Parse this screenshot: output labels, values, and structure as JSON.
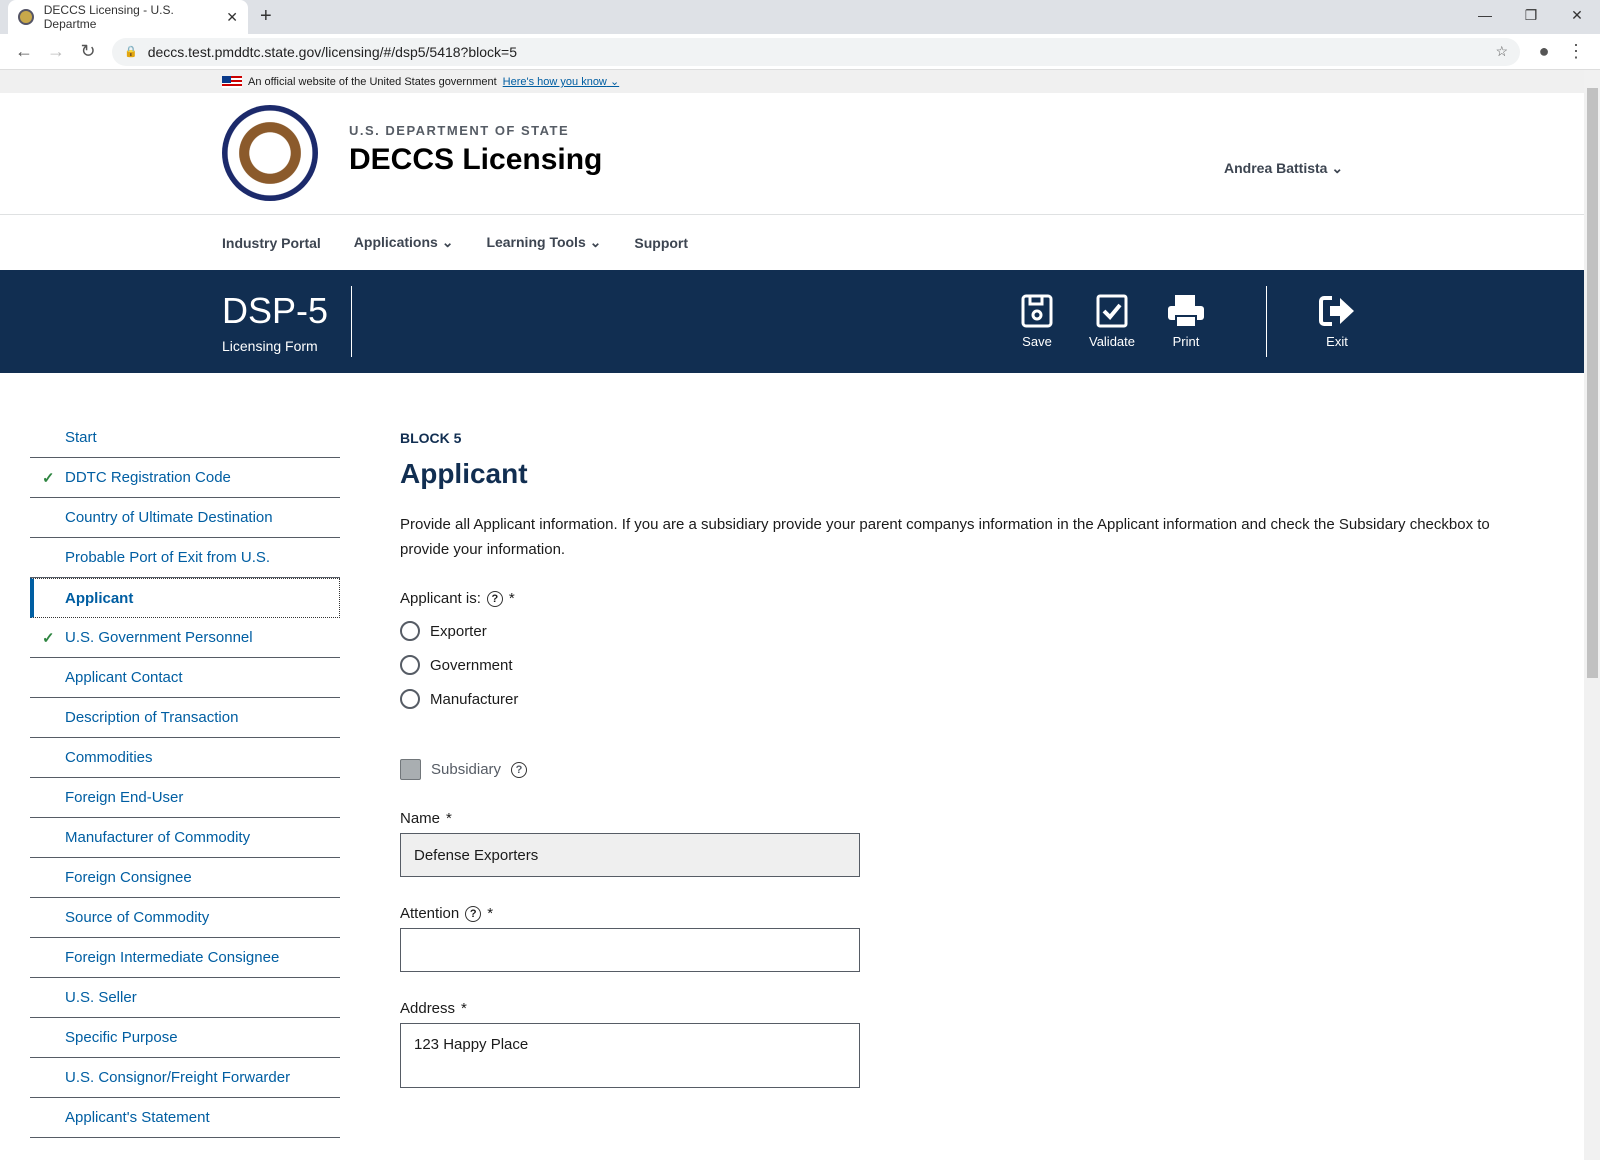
{
  "browser": {
    "tab_title": "DECCS Licensing - U.S. Departme",
    "url": "deccs.test.pmddtc.state.gov/licensing/#/dsp5/5418?block=5"
  },
  "gov_banner": {
    "text": "An official website of the United States government",
    "link": "Here's how you know"
  },
  "header": {
    "agency": "U.S. DEPARTMENT OF STATE",
    "title": "DECCS Licensing",
    "user": "Andrea Battista",
    "seal_text": "DEPARTMENT OF STATE UNITED STATES OF AMERICA"
  },
  "nav": [
    "Industry Portal",
    "Applications",
    "Learning Tools",
    "Support"
  ],
  "banner": {
    "form": "DSP-5",
    "subtitle": "Licensing Form",
    "save": "Save",
    "validate": "Validate",
    "print": "Print",
    "exit": "Exit",
    "bg_color": "#112e51"
  },
  "sidebar": [
    {
      "label": "Start",
      "done": false
    },
    {
      "label": "DDTC Registration Code",
      "done": true
    },
    {
      "label": "Country of Ultimate Destination",
      "done": false
    },
    {
      "label": "Probable Port of Exit from U.S.",
      "done": false
    },
    {
      "label": "Applicant",
      "done": false,
      "active": true
    },
    {
      "label": "U.S. Government Personnel",
      "done": true
    },
    {
      "label": "Applicant Contact",
      "done": false
    },
    {
      "label": "Description of Transaction",
      "done": false
    },
    {
      "label": "Commodities",
      "done": false
    },
    {
      "label": "Foreign End-User",
      "done": false
    },
    {
      "label": "Manufacturer of Commodity",
      "done": false
    },
    {
      "label": "Foreign Consignee",
      "done": false
    },
    {
      "label": "Source of Commodity",
      "done": false
    },
    {
      "label": "Foreign Intermediate Consignee",
      "done": false
    },
    {
      "label": "U.S. Seller",
      "done": false
    },
    {
      "label": "Specific Purpose",
      "done": false
    },
    {
      "label": "U.S. Consignor/Freight Forwarder",
      "done": false
    },
    {
      "label": "Applicant's Statement",
      "done": false
    }
  ],
  "main": {
    "block": "BLOCK 5",
    "title": "Applicant",
    "description": "Provide all Applicant information. If you are a subsidiary provide your parent companys information in the Applicant information and check the Subsidary checkbox to provide your information.",
    "applicant_is": "Applicant is:",
    "options": [
      "Exporter",
      "Government",
      "Manufacturer"
    ],
    "subsidiary": "Subsidiary",
    "name_label": "Name",
    "name_value": "Defense Exporters",
    "attention_label": "Attention",
    "attention_value": "",
    "address_label": "Address",
    "address_value": "123 Happy Place",
    "required": "*"
  }
}
